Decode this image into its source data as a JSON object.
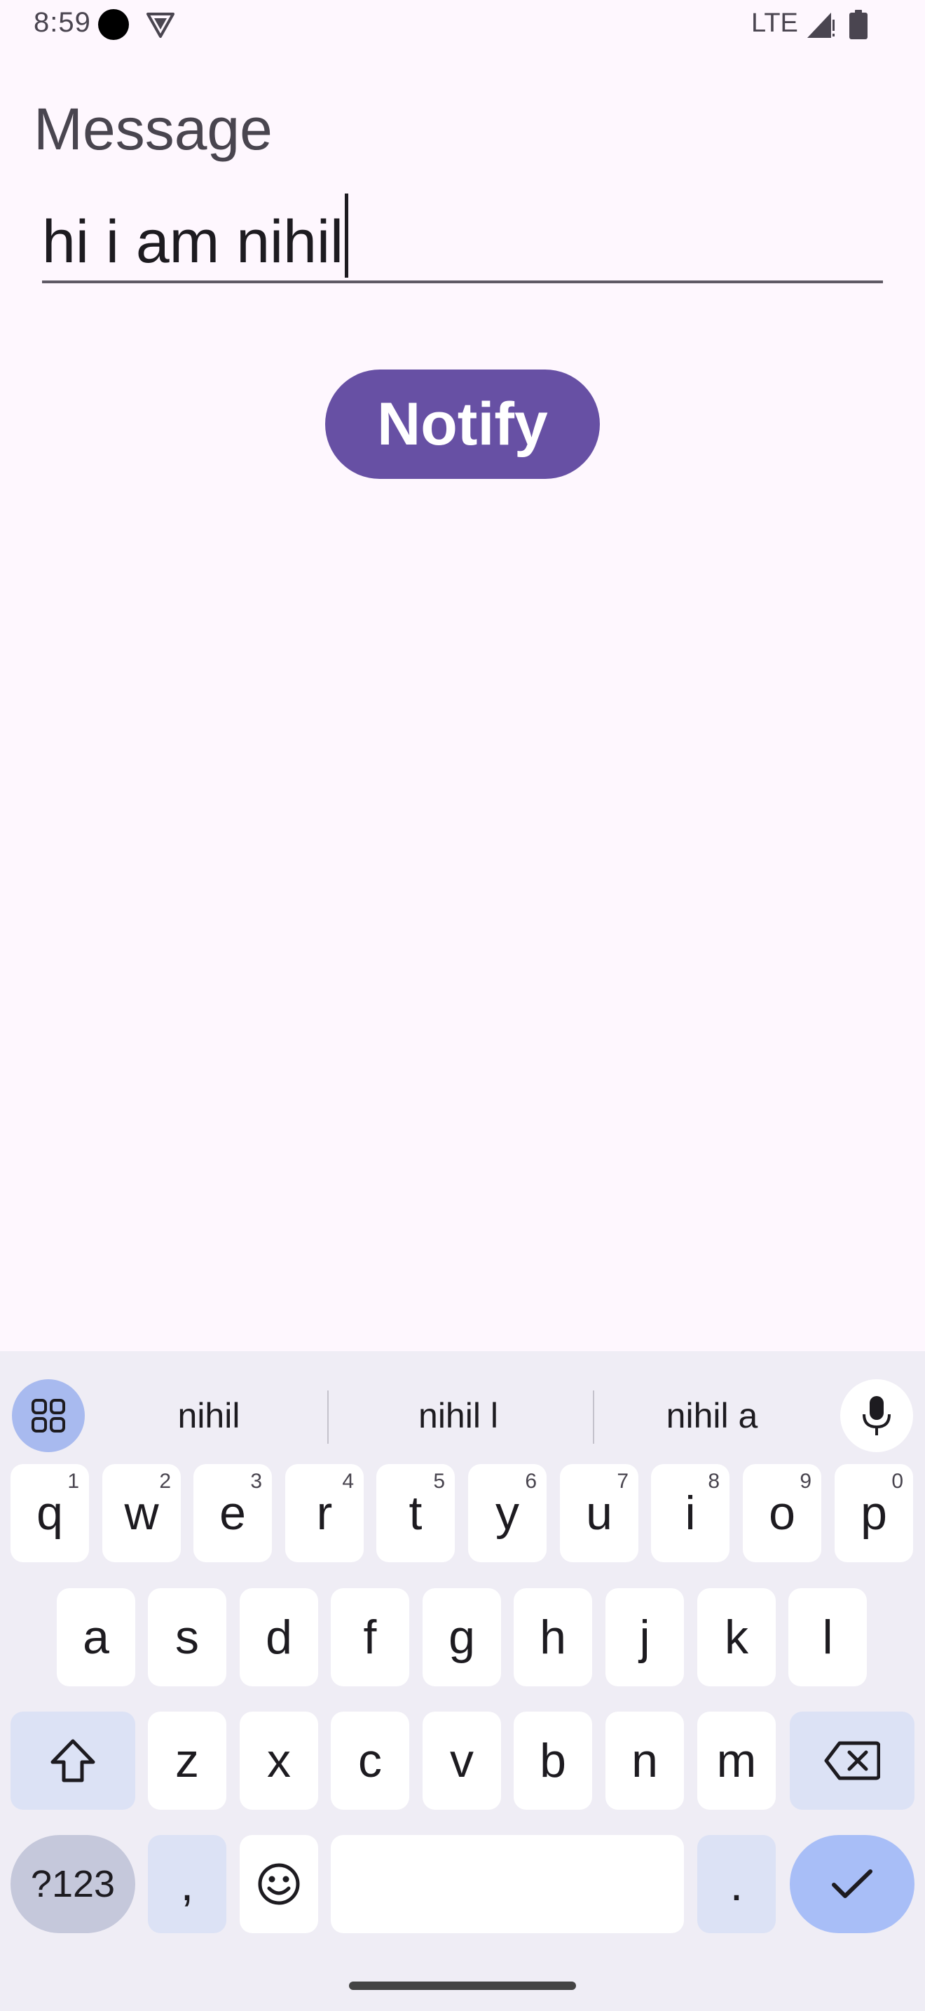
{
  "status_bar": {
    "time": "8:59",
    "network": "LTE",
    "icons": [
      "record-dot-icon",
      "vpn-shield-icon",
      "signal-icon",
      "battery-icon"
    ]
  },
  "message_field": {
    "label": "Message",
    "value": "hi i am nihil"
  },
  "notify_button": {
    "label": "Notify"
  },
  "keyboard": {
    "suggestions": [
      "nihil",
      "nihil l",
      "nihil a"
    ],
    "row1": [
      {
        "key": "q",
        "hint": "1"
      },
      {
        "key": "w",
        "hint": "2"
      },
      {
        "key": "e",
        "hint": "3"
      },
      {
        "key": "r",
        "hint": "4"
      },
      {
        "key": "t",
        "hint": "5"
      },
      {
        "key": "y",
        "hint": "6"
      },
      {
        "key": "u",
        "hint": "7"
      },
      {
        "key": "i",
        "hint": "8"
      },
      {
        "key": "o",
        "hint": "9"
      },
      {
        "key": "p",
        "hint": "0"
      }
    ],
    "row2": [
      "a",
      "s",
      "d",
      "f",
      "g",
      "h",
      "j",
      "k",
      "l"
    ],
    "row3": [
      "z",
      "x",
      "c",
      "v",
      "b",
      "n",
      "m"
    ],
    "symbols_label": "?123",
    "comma_label": ",",
    "period_label": "."
  },
  "colors": {
    "background": "#FEF7FE",
    "accent": "#6750A4",
    "keyboard_bg": "#EFEDF5",
    "enter_key": "#A8BEF7"
  }
}
